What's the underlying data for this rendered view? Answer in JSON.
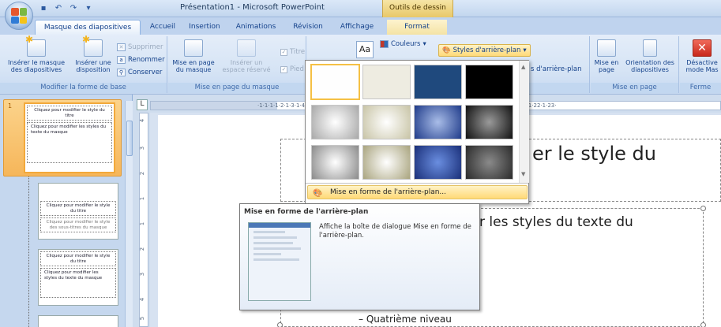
{
  "window": {
    "title": "Présentation1 - Microsoft PowerPoint",
    "contextual_tab_group": "Outils de dessin"
  },
  "tabs": [
    {
      "label": "Masque des diapositives",
      "active": true
    },
    {
      "label": "Accueil"
    },
    {
      "label": "Insertion"
    },
    {
      "label": "Animations"
    },
    {
      "label": "Révision"
    },
    {
      "label": "Affichage"
    },
    {
      "label": "Format",
      "contextual": true
    }
  ],
  "ribbon": {
    "group_modifier": {
      "label": "Modifier la forme de base",
      "insert_master_line1": "Insérer le masque",
      "insert_master_line2": "des diapositives",
      "insert_layout_line1": "Insérer une",
      "insert_layout_line2": "disposition",
      "delete": "Supprimer",
      "rename": "Renommer",
      "preserve": "Conserver"
    },
    "group_mise_en_page_masque": {
      "label": "Mise en page du masque",
      "master_layout_line1": "Mise en page",
      "master_layout_line2": "du masque",
      "insert_placeholder_line1": "Insérer un",
      "insert_placeholder_line2": "espace réservé",
      "title_check": "Titre",
      "footer_check": "Pied"
    },
    "group_theme": {
      "fonts_icon_text": "Aa",
      "colors": "Couleurs",
      "bg_styles": "Styles d'arrière-plan",
      "hide_bg": "s d'arrière-plan"
    },
    "group_mise_en_page": {
      "label": "Mise en page",
      "page_setup_line1": "Mise en",
      "page_setup_line2": "page",
      "orientation_line1": "Orientation des",
      "orientation_line2": "diapositives"
    },
    "group_close": {
      "label": "Ferme",
      "close_line1": "Désactive",
      "close_line2": "mode Mas"
    }
  },
  "gallery": {
    "rows": [
      [
        "#fefefe",
        "#eeece1",
        "#1f497d",
        "#000000"
      ],
      [
        "radial-gray",
        "radial-tan",
        "radial-blue",
        "radial-black"
      ],
      [
        "radial-gray-dark",
        "radial-tan-dark",
        "radial-blue-dark",
        "radial-black-dark"
      ]
    ],
    "command": "Mise en forme de l'arrière-plan..."
  },
  "tooltip": {
    "title": "Mise en forme de l'arrière-plan",
    "description": "Affiche la boîte de dialogue Mise en forme de l'arrière-plan."
  },
  "slide": {
    "title_fragment": "er le style du",
    "body_fragment": "r les styles du texte du",
    "level4": "Quatrième niveau"
  },
  "thumbnails": {
    "slide_number": "1",
    "master_title": "Cliquez pour modifier le style du titre",
    "master_body": "Cliquez pour modifier les styles du texte du masque",
    "layout_title": "Cliquez pour modifier le style du titre",
    "layout_sub": "Cliquez pour modifier le style des sous-titres du masque"
  },
  "ruler": {
    "top": "·1·1·1·1·2·1·3·1·4·1·5·1·6·1·7·1·8·1·9·1·10·1·11·1·12·1·13·1·14·1·15·1·16·1·17·1·18·1·19·1·20·1·21·1·22·1·23·",
    "vertical": [
      "4",
      "3",
      "2",
      "1",
      "1",
      "2",
      "3",
      "4",
      "5",
      "6"
    ]
  },
  "colors": {
    "ribbon_bg": "#d6e4f5",
    "accent_orange": "#f6b65a",
    "highlight_yellow": "#ffd977"
  }
}
